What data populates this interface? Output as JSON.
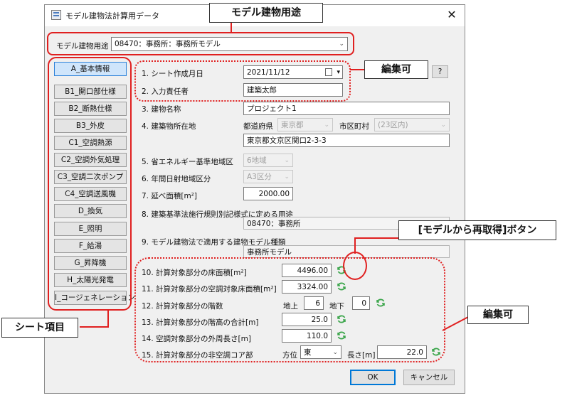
{
  "window": {
    "title": "モデル建物法計算用データ",
    "close": "✕"
  },
  "usage": {
    "label": "モデル建物用途",
    "value": "08470：事務所：事務所モデル"
  },
  "sidebar": {
    "items": [
      {
        "label": "A_基本情報",
        "active": true
      },
      {
        "label": "B1_開口部仕様"
      },
      {
        "label": "B2_断熱仕様"
      },
      {
        "label": "B3_外皮"
      },
      {
        "label": "C1_空調熱源"
      },
      {
        "label": "C2_空調外気処理"
      },
      {
        "label": "C3_空調二次ポンプ"
      },
      {
        "label": "C4_空調送風機"
      },
      {
        "label": "D_換気"
      },
      {
        "label": "E_照明"
      },
      {
        "label": "F_給湯"
      },
      {
        "label": "G_昇降機"
      },
      {
        "label": "H_太陽光発電"
      },
      {
        "label": "I_コージェネレーション"
      }
    ]
  },
  "form": {
    "f1": {
      "label": "1. シート作成月日",
      "value": "2021/11/12",
      "help": "?"
    },
    "f2": {
      "label": "2. 入力責任者",
      "value": "建築太郎"
    },
    "f3": {
      "label": "3. 建物名称",
      "value": "プロジェクト1"
    },
    "f4": {
      "label": "4. 建築物所在地",
      "pref_label": "都道府県",
      "pref_value": "東京都",
      "city_label": "市区町村",
      "city_value": "(23区内)",
      "address": "東京都文京区関口2-3-3"
    },
    "f5": {
      "label": "5. 省エネルギー基準地域区",
      "value": "6地域"
    },
    "f6": {
      "label": "6. 年間日射地域区分",
      "value": "A3区分"
    },
    "f7": {
      "label": "7. 延べ面積[m²]",
      "value": "2000.00"
    },
    "f8": {
      "label": "8. 建築基準法施行規則別記様式に定める用途",
      "value": "08470：事務所"
    },
    "f9": {
      "label": "9. モデル建物法で適用する建物モデル種類",
      "value": "事務所モデル"
    },
    "f10": {
      "label": "10. 計算対象部分の床面積[m²]",
      "value": "4496.00"
    },
    "f11": {
      "label": "11. 計算対象部分の空調対象床面積[m²]",
      "value": "3324.00"
    },
    "f12": {
      "label": "12. 計算対象部分の階数",
      "above_label": "地上",
      "above_value": "6",
      "below_label": "地下",
      "below_value": "0"
    },
    "f13": {
      "label": "13. 計算対象部分の階高の合計[m]",
      "value": "25.0"
    },
    "f14": {
      "label": "14. 空調対象部分の外周長さ[m]",
      "value": "110.0"
    },
    "f15": {
      "label": "15. 計算対象部分の非空調コア部",
      "dir_label": "方位",
      "dir_value": "東",
      "len_label": "長さ[m]",
      "len_value": "22.0"
    }
  },
  "buttons": {
    "ok": "OK",
    "cancel": "キャンセル"
  },
  "callouts": {
    "usage": "モデル建物用途",
    "editable_top": "編集可",
    "refetch": "[モデルから再取得]ボタン",
    "sheet_items": "シート項目",
    "editable_bottom": "編集可"
  },
  "colors": {
    "annotation": "#e02020",
    "active_tab": "#cfe5fb",
    "refresh_icon": "#3aa54a"
  }
}
